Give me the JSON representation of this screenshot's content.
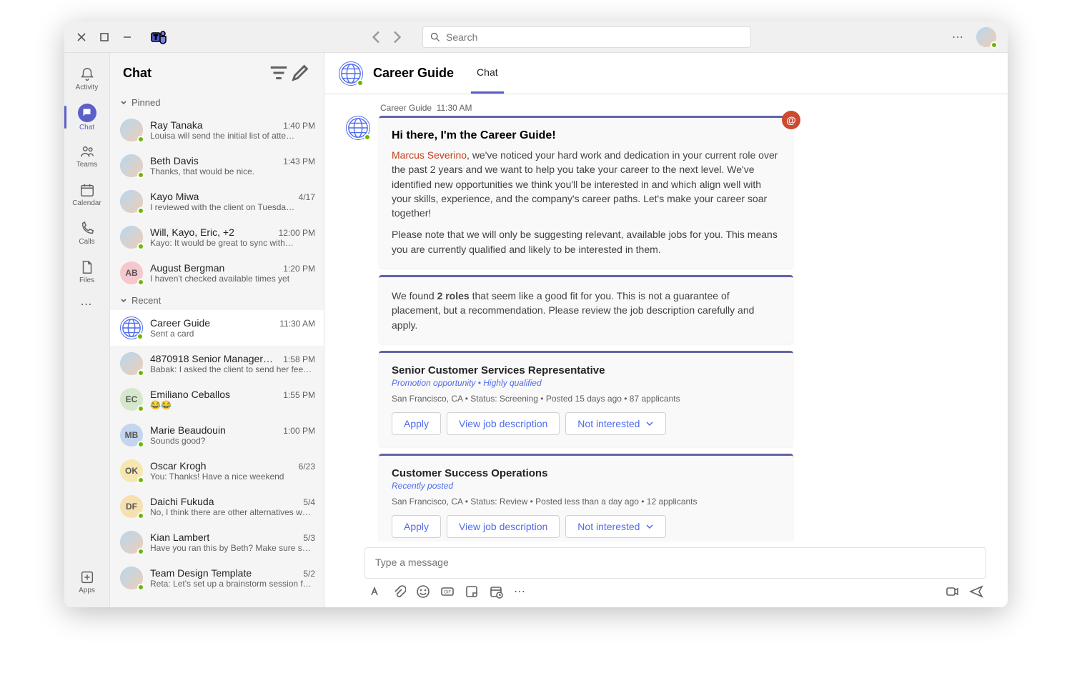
{
  "search": {
    "placeholder": "Search"
  },
  "rail": {
    "activity": "Activity",
    "chat": "Chat",
    "teams": "Teams",
    "calendar": "Calendar",
    "calls": "Calls",
    "files": "Files",
    "apps": "Apps"
  },
  "chatlist": {
    "title": "Chat",
    "pinned_label": "Pinned",
    "recent_label": "Recent",
    "pinned": [
      {
        "name": "Ray Tanaka",
        "time": "1:40 PM",
        "preview": "Louisa will send the initial list of atte…"
      },
      {
        "name": "Beth Davis",
        "time": "1:43 PM",
        "preview": "Thanks, that would be nice."
      },
      {
        "name": "Kayo Miwa",
        "time": "4/17",
        "preview": "I reviewed with the client on Tuesda…"
      },
      {
        "name": "Will, Kayo, Eric, +2",
        "time": "12:00 PM",
        "preview": "Kayo: It would be great to sync with…"
      },
      {
        "name": "August Bergman",
        "time": "1:20 PM",
        "preview": "I haven't checked available times yet",
        "initials": "AB"
      }
    ],
    "recent": [
      {
        "name": "Career Guide",
        "time": "11:30 AM",
        "preview": "Sent a card",
        "globe": true
      },
      {
        "name": "4870918 Senior Manager…",
        "time": "1:58 PM",
        "preview": "Babak: I asked the client to send her feed…"
      },
      {
        "name": "Emiliano Ceballos",
        "time": "1:55 PM",
        "preview": "😂😂",
        "initials": "EC"
      },
      {
        "name": "Marie Beaudouin",
        "time": "1:00 PM",
        "preview": "Sounds good?",
        "initials": "MB"
      },
      {
        "name": "Oscar Krogh",
        "time": "6/23",
        "preview": "You: Thanks! Have a nice weekend",
        "initials": "OK"
      },
      {
        "name": "Daichi Fukuda",
        "time": "5/4",
        "preview": "No, I think there are other alternatives we c…",
        "initials": "DF"
      },
      {
        "name": "Kian Lambert",
        "time": "5/3",
        "preview": "Have you ran this by Beth? Make sure she is…"
      },
      {
        "name": "Team Design Template",
        "time": "5/2",
        "preview": "Reta: Let's set up a brainstorm session for…"
      }
    ]
  },
  "chatHeader": {
    "title": "Career Guide",
    "tab_chat": "Chat"
  },
  "message": {
    "sender": "Career Guide",
    "time": "11:30 AM",
    "intro_title": "Hi there, I'm the Career Guide!",
    "intro_mention": "Marcus Severino",
    "intro_body1": ", we've noticed your hard work and dedication in your current role over the past 2 years and we want to help you take your career to the next level. We've identified new opportunities we think you'll be interested in and which align well with your skills, experience, and the company's career paths. Let's make your career soar together!",
    "intro_body2": "Please note that we will only be suggesting relevant, available jobs for you. This means you are currently qualified and likely to be interested in them.",
    "found_prefix": "We found ",
    "found_bold": "2 roles",
    "found_suffix": " that seem like a good fit for you. This is not a guarantee of placement, but a recommendation. Please review the job description carefully and apply.",
    "jobs": [
      {
        "title": "Senior Customer Services Representative",
        "tags": "Promotion opportunity  •  Highly qualified",
        "meta": "San Francisco, CA • Status: Screening • Posted 15 days ago • 87 applicants"
      },
      {
        "title": "Customer Success Operations",
        "tags": "Recently posted",
        "meta": "San Francisco, CA • Status: Review • Posted less than a day ago • 12 applicants"
      }
    ],
    "btn_apply": "Apply",
    "btn_view": "View job description",
    "btn_not": "Not interested"
  },
  "composer": {
    "placeholder": "Type a message"
  }
}
